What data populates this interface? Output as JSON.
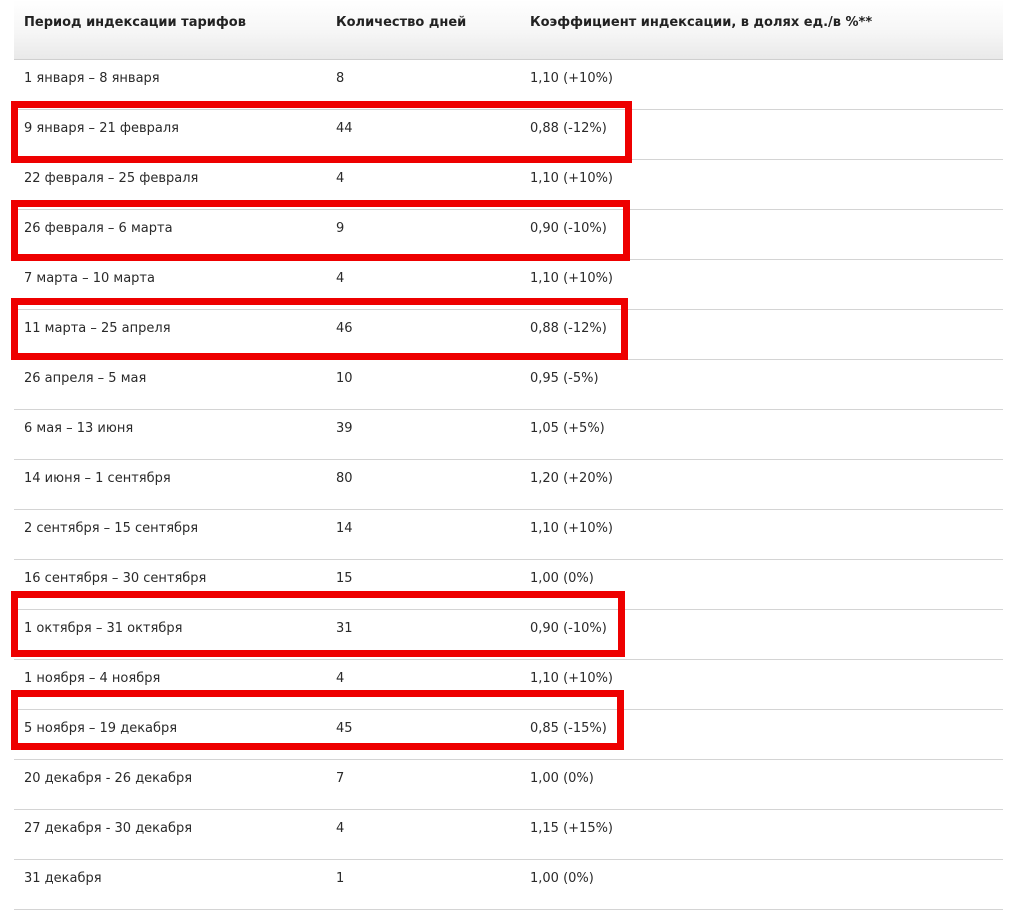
{
  "table": {
    "columns": [
      "Период индексации тарифов",
      "Количество дней",
      "Коэффициент индексации, в долях ед./в %**"
    ],
    "rows": [
      {
        "period": "1 января – 8 января",
        "days": "8",
        "coef": "1,10 (+10%)"
      },
      {
        "period": "9 января – 21 февраля",
        "days": "44",
        "coef": "0,88 (-12%)"
      },
      {
        "period": "22 февраля – 25 февраля",
        "days": "4",
        "coef": "1,10 (+10%)"
      },
      {
        "period": "26 февраля – 6 марта",
        "days": "9",
        "coef": "0,90 (-10%)"
      },
      {
        "period": "7 марта – 10 марта",
        "days": "4",
        "coef": "1,10 (+10%)"
      },
      {
        "period": "11 марта – 25 апреля",
        "days": "46",
        "coef": "0,88 (-12%)"
      },
      {
        "period": "26 апреля – 5 мая",
        "days": "10",
        "coef": "0,95 (-5%)"
      },
      {
        "period": "6 мая – 13 июня",
        "days": "39",
        "coef": "1,05 (+5%)"
      },
      {
        "period": "14 июня – 1 сентября",
        "days": "80",
        "coef": "1,20 (+20%)"
      },
      {
        "period": "2 сентября – 15 сентября",
        "days": "14",
        "coef": "1,10 (+10%)"
      },
      {
        "period": "16 сентября – 30 сентября",
        "days": "15",
        "coef": "1,00 (0%)"
      },
      {
        "period": "1 октября – 31 октября",
        "days": "31",
        "coef": "0,90 (-10%)"
      },
      {
        "period": "1 ноября – 4 ноября",
        "days": "4",
        "coef": "1,10 (+10%)"
      },
      {
        "period": "5 ноября – 19 декабря",
        "days": "45",
        "coef": "0,85 (-15%)"
      },
      {
        "period": "20 декабря - 26 декабря",
        "days": "7",
        "coef": "1,00 (0%)"
      },
      {
        "period": "27 декабря - 30 декабря",
        "days": "4",
        "coef": "1,15 (+15%)"
      },
      {
        "period": "31 декабря",
        "days": "1",
        "coef": "1,00 (0%)"
      }
    ]
  },
  "highlight_color": "#ee0000",
  "highlighted_rows": [
    1,
    3,
    5,
    11,
    13
  ]
}
